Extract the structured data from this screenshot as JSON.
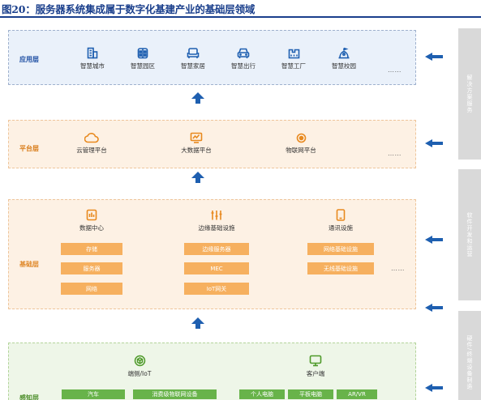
{
  "title": "图20：服务器系统集成属于数字化基建产业的基础层领域",
  "layers": {
    "app": {
      "label": "应用层",
      "items": [
        {
          "label": "智慧城市",
          "icon": "building-icon"
        },
        {
          "label": "智慧园区",
          "icon": "campus-icon"
        },
        {
          "label": "智慧家居",
          "icon": "sofa-icon"
        },
        {
          "label": "智慧出行",
          "icon": "car-icon"
        },
        {
          "label": "智慧工厂",
          "icon": "factory-icon"
        },
        {
          "label": "智慧校园",
          "icon": "school-icon"
        }
      ],
      "more": "……"
    },
    "platform": {
      "label": "平台层",
      "items": [
        {
          "label": "云管理平台",
          "icon": "cloud-icon"
        },
        {
          "label": "大数据平台",
          "icon": "monitor-chart-icon"
        },
        {
          "label": "物联网平台",
          "icon": "iot-icon"
        }
      ],
      "more": "……"
    },
    "base": {
      "label": "基础层",
      "groups": [
        {
          "label": "数据中心",
          "icon": "datacenter-icon",
          "boxes": [
            "存储",
            "服务器",
            "网络"
          ]
        },
        {
          "label": "边缘基础设施",
          "icon": "edge-icon",
          "boxes": [
            "边缘服务器",
            "MEC",
            "IoT网关"
          ]
        },
        {
          "label": "通讯设施",
          "icon": "phone-icon",
          "boxes": [
            "网络基础设施",
            "无线基础设施"
          ]
        }
      ],
      "more": "……"
    },
    "sense": {
      "label": "感知层",
      "groups": [
        {
          "label": "端侧/IoT",
          "icon": "cube-icon",
          "boxes": [
            "汽车",
            "消费级物联网设备"
          ]
        },
        {
          "label": "客户端",
          "icon": "screen-icon",
          "boxes": [
            "个人电脑",
            "平板电脑",
            "AR/VR"
          ]
        }
      ]
    }
  },
  "side": {
    "solution": "解决方案服务",
    "software": "软件开发和运营",
    "hardware": "硬件/终端设备制造"
  },
  "colors": {
    "title": "#1a3f8c",
    "app_bg": "#eaf1fa",
    "orange_bg": "#fdf1e4",
    "orange_box": "#f6b05f",
    "green_bg": "#eef6e8",
    "green_box": "#68b34a",
    "arrow": "#1e5fb0",
    "side_panel": "#d9d9d9"
  }
}
